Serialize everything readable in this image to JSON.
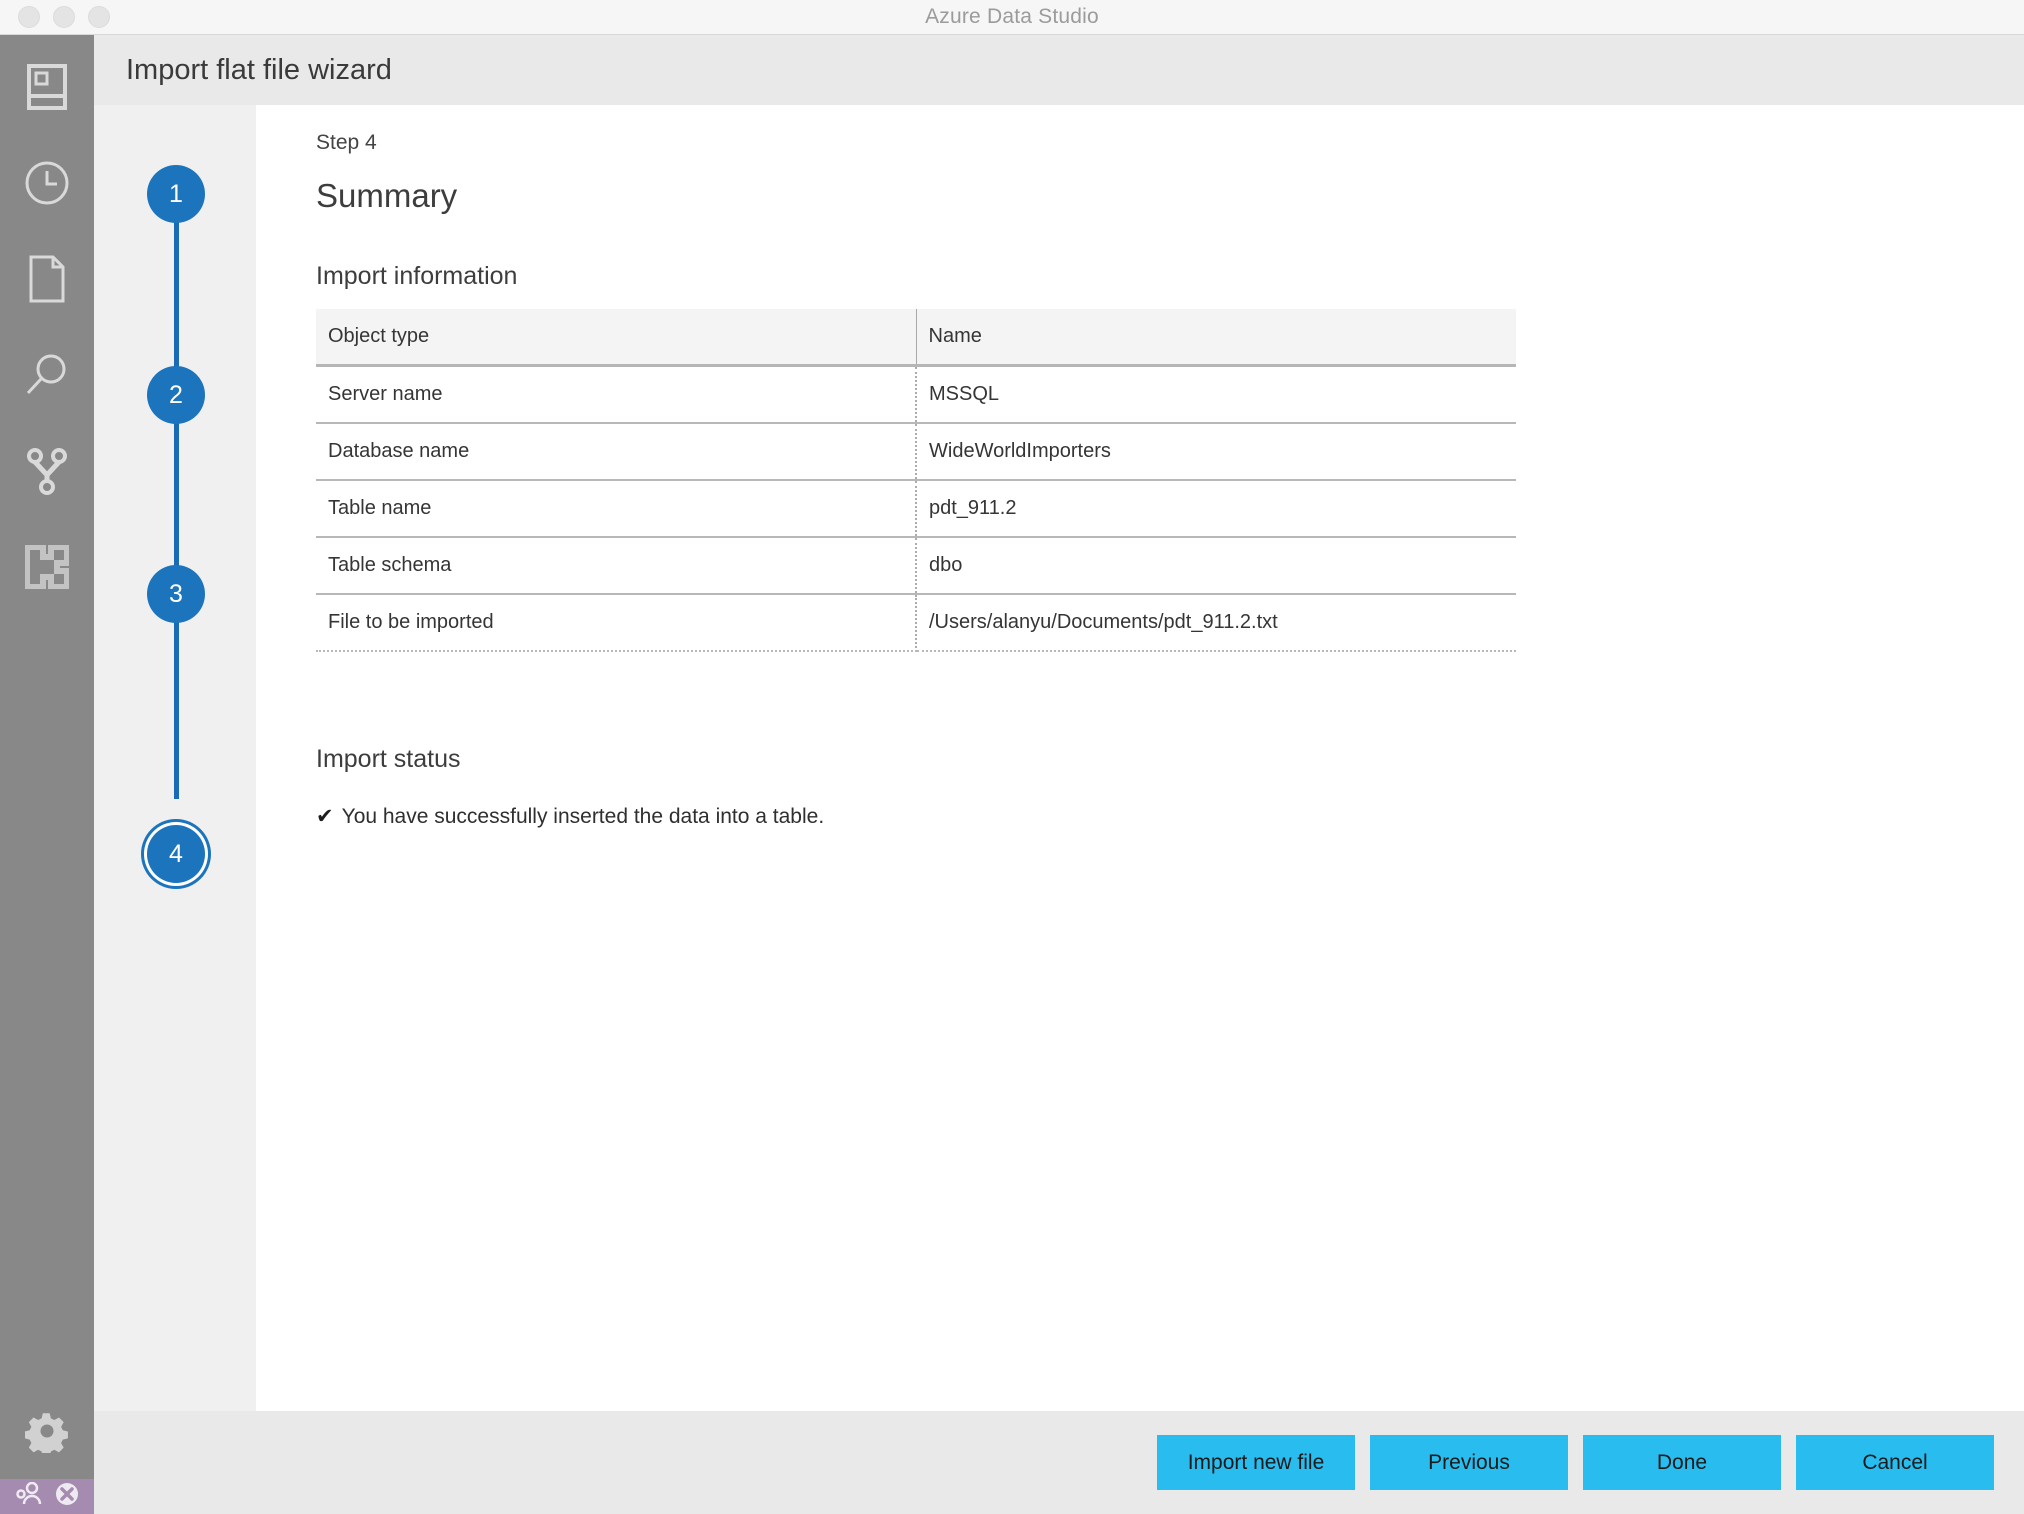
{
  "window": {
    "app_title": "Azure Data Studio",
    "traffic_lights": [
      "close-button",
      "minimize-button",
      "maximize-button"
    ]
  },
  "activity_bar": {
    "items": [
      {
        "icon": "servers-icon",
        "name": "sidebar-item-servers"
      },
      {
        "icon": "clock-icon",
        "name": "sidebar-item-history"
      },
      {
        "icon": "file-icon",
        "name": "sidebar-item-explorer"
      },
      {
        "icon": "search-icon",
        "name": "sidebar-item-search"
      },
      {
        "icon": "source-control-icon",
        "name": "sidebar-item-source-control"
      },
      {
        "icon": "extensions-icon",
        "name": "sidebar-item-extensions"
      }
    ],
    "bottom_items": [
      {
        "icon": "gear-icon",
        "name": "sidebar-item-settings"
      }
    ]
  },
  "status_bar": {
    "remote_icon": "accounts-icon",
    "error_icon": "error-icon",
    "background": "#a58bb0"
  },
  "wizard": {
    "title": "Import flat file wizard",
    "steps": [
      {
        "number": "1",
        "active": false
      },
      {
        "number": "2",
        "active": false
      },
      {
        "number": "3",
        "active": false
      },
      {
        "number": "4",
        "active": true
      }
    ]
  },
  "page": {
    "step_label": "Step 4",
    "heading": "Summary",
    "import_information": {
      "heading": "Import information",
      "columns": [
        "Object type",
        "Name"
      ],
      "rows": [
        [
          "Server name",
          "MSSQL"
        ],
        [
          "Database name",
          "WideWorldImporters"
        ],
        [
          "Table name",
          "pdt_911.2"
        ],
        [
          "Table schema",
          "dbo"
        ],
        [
          "File to be imported",
          "/Users/alanyu/Documents/pdt_911.2.txt"
        ]
      ]
    },
    "import_status": {
      "heading": "Import status",
      "check": "✔",
      "message": "You have successfully inserted the data into a table."
    }
  },
  "footer": {
    "buttons": [
      {
        "label": "Import new file",
        "name": "import-new-file-button"
      },
      {
        "label": "Previous",
        "name": "previous-button"
      },
      {
        "label": "Done",
        "name": "done-button"
      },
      {
        "label": "Cancel",
        "name": "cancel-button"
      }
    ],
    "accent_color": "#29bcef"
  }
}
